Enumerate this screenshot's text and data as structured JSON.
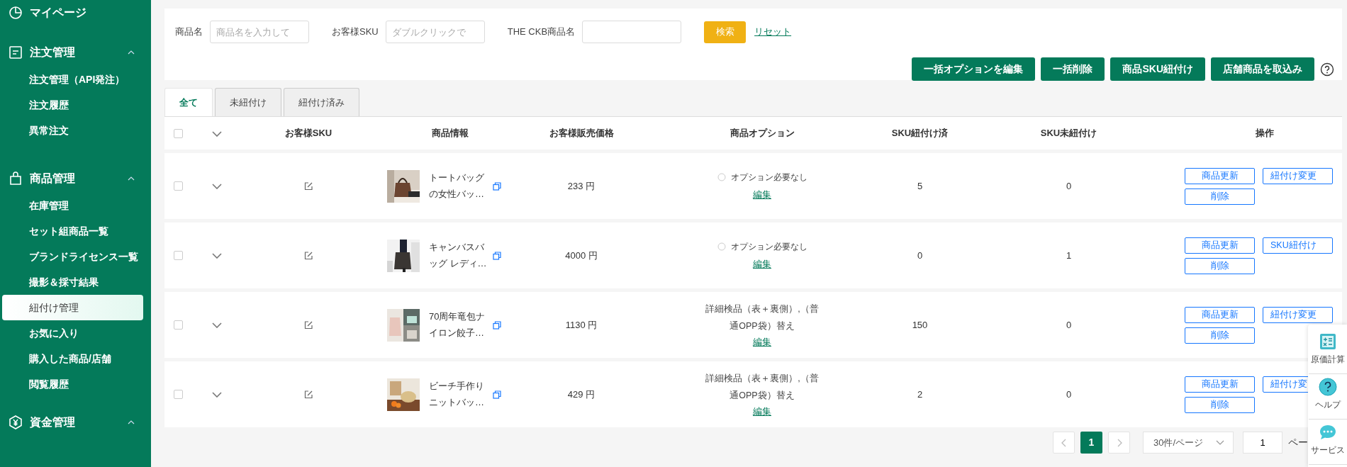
{
  "sidebar": {
    "sections": [
      {
        "title": "マイページ"
      },
      {
        "title": "注文管理",
        "expanded": true,
        "items": [
          {
            "label": "注文管理（API発注）",
            "selected": false
          },
          {
            "label": "注文履歴",
            "selected": false
          },
          {
            "label": "異常注文",
            "selected": false
          }
        ]
      },
      {
        "title": "商品管理",
        "expanded": true,
        "items": [
          {
            "label": "在庫管理",
            "selected": false
          },
          {
            "label": "セット組商品一覧",
            "selected": false
          },
          {
            "label": "ブランドライセンス一覧",
            "selected": false
          },
          {
            "label": "撮影＆採寸結果",
            "selected": false
          },
          {
            "label": "紐付け管理",
            "selected": true
          },
          {
            "label": "お気に入り",
            "selected": false
          },
          {
            "label": "購入した商品/店舗",
            "selected": false
          },
          {
            "label": "閲覧履歴",
            "selected": false
          }
        ]
      },
      {
        "title": "資金管理",
        "expanded": true
      }
    ]
  },
  "filters": [
    {
      "label": "商品名",
      "placeholder": "商品名を入力して"
    },
    {
      "label": "お客様SKU",
      "placeholder": "ダブルクリックで"
    },
    {
      "label": "THE CKB商品名"
    }
  ],
  "search_button": "検索",
  "reset_link": "リセット",
  "bulk_buttons": [
    "一括オプションを編集",
    "一括削除",
    "商品SKU紐付け",
    "店舗商品を取込み"
  ],
  "tabs": [
    {
      "label": "全て",
      "selected": true
    },
    {
      "label": "未紐付け",
      "selected": false
    },
    {
      "label": "紐付け済み",
      "selected": false
    }
  ],
  "table": {
    "all_checked": false,
    "columns": [
      "お客様SKU",
      "商品情報",
      "お客様販売価格",
      "商品オプション",
      "SKU紐付け済",
      "SKU未紐付け",
      "操作"
    ],
    "rows": [
      {
        "checked": false,
        "name": "トートバッグの女性バッ…",
        "price": "233 円",
        "option": {
          "kind": "radio",
          "checked": false,
          "text": "オプション必要なし"
        },
        "edit": "編集",
        "linked": "5",
        "unlinked": "0",
        "actions": [
          "商品更新",
          "紐付け変更",
          "削除"
        ]
      },
      {
        "checked": false,
        "name": "キャンバスバッグ レディ…",
        "price": "4000 円",
        "option": {
          "kind": "radio",
          "checked": false,
          "text": "オプション必要なし"
        },
        "edit": "編集",
        "linked": "0",
        "unlinked": "1",
        "actions": [
          "商品更新",
          "SKU紐付け",
          "削除"
        ]
      },
      {
        "checked": false,
        "name": "70周年竜包ナイロン餃子…",
        "price": "1130 円",
        "option": {
          "kind": "text",
          "text": "詳細検品（表＋裏側）,（普通OPP袋）替え"
        },
        "edit": "編集",
        "linked": "150",
        "unlinked": "0",
        "actions": [
          "商品更新",
          "紐付け変更",
          "削除"
        ]
      },
      {
        "checked": false,
        "name": "ビーチ手作りニットバッ…",
        "price": "429 円",
        "option": {
          "kind": "text",
          "text": "詳細検品（表＋裏側）,（普通OPP袋）替え"
        },
        "edit": "編集",
        "linked": "2",
        "unlinked": "0",
        "actions": [
          "商品更新",
          "紐付け変",
          "削除"
        ]
      }
    ]
  },
  "pagination": {
    "pages": [
      {
        "label": "1",
        "selected": true
      }
    ],
    "page_size": "30件/ページ",
    "jump_value": "1",
    "jump_label": "ペー"
  },
  "float_panel": [
    "原価計算",
    "ヘルプ",
    "サービス"
  ]
}
